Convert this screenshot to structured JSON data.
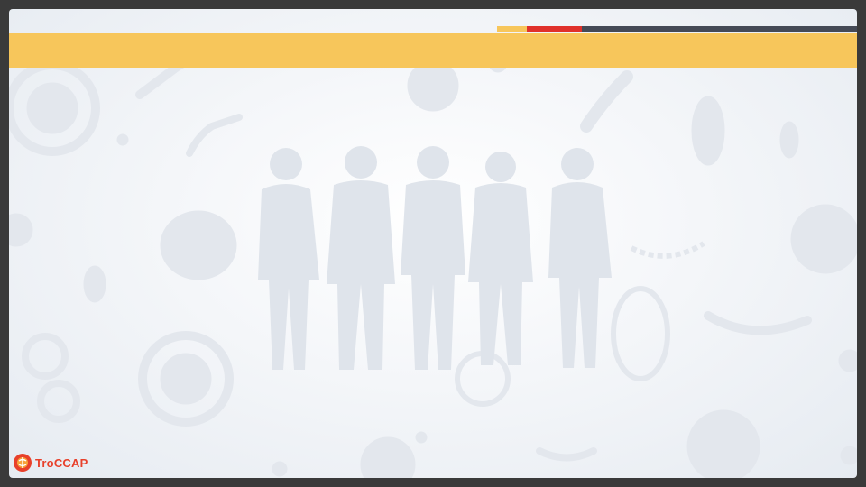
{
  "colors": {
    "frame": "#3a3a3a",
    "title_band": "#f7c65b",
    "accent_yellow": "#f7c65b",
    "accent_red": "#e0312b",
    "accent_dark": "#454a56",
    "silhouette": "#dde2ea",
    "microbe": "#e2e6ec",
    "logo_text": "#e8402a"
  },
  "slide": {
    "title": ""
  },
  "logo": {
    "text": "TroCCAP",
    "icon": "troccap-logo-icon"
  }
}
